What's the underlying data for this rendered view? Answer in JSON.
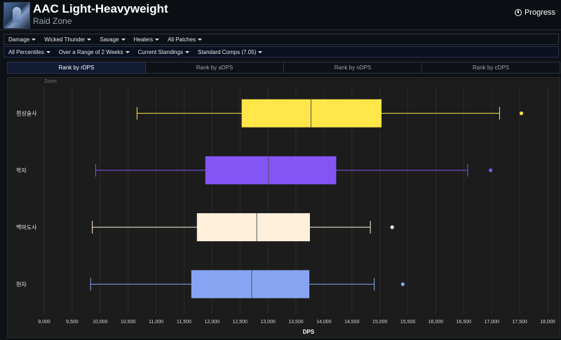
{
  "header": {
    "title": "AAC Light-Heavyweight",
    "subtitle": "Raid Zone",
    "progress_label": "Progress"
  },
  "filters_row1": [
    {
      "label": "Damage"
    },
    {
      "label": "Wicked Thunder"
    },
    {
      "label": "Savage"
    },
    {
      "label": "Healers"
    },
    {
      "label": "All Patches"
    }
  ],
  "filters_row2": [
    {
      "label": "All Percentiles"
    },
    {
      "label": "Over a Range of 2 Weeks"
    },
    {
      "label": "Current Standings"
    },
    {
      "label": "Standard Comps (7.05)"
    }
  ],
  "tabs": [
    {
      "label": "Rank by rDPS",
      "active": true
    },
    {
      "label": "Rank by aDPS",
      "active": false
    },
    {
      "label": "Rank by nDPS",
      "active": false
    },
    {
      "label": "Rank by cDPS",
      "active": false
    }
  ],
  "chart_zoom_label": "Zoom",
  "chart_data": {
    "type": "boxplot",
    "orientation": "horizontal",
    "xlabel": "DPS",
    "xlim": [
      9000,
      18000
    ],
    "xticks": [
      9000,
      9500,
      10000,
      10500,
      11000,
      11500,
      12000,
      12500,
      13000,
      13500,
      14000,
      14500,
      15000,
      15500,
      16000,
      16500,
      17000,
      17500,
      18000
    ],
    "xtick_labels": [
      "9,000",
      "9,500",
      "10,000",
      "10,500",
      "11,000",
      "11,500",
      "12,000",
      "12,500",
      "13,000",
      "13,500",
      "14,000",
      "14,500",
      "15,000",
      "15,500",
      "16,000",
      "16,500",
      "17,000",
      "17,500",
      "18,000"
    ],
    "grid": true,
    "series": [
      {
        "name": "점성술사",
        "color": "#ffe74a",
        "whisker_low": 10660,
        "q1": 12530,
        "median": 13770,
        "q3": 15030,
        "whisker_high": 17140,
        "outliers": [
          17530
        ]
      },
      {
        "name": "학자",
        "color": "#8454f5",
        "whisker_low": 9920,
        "q1": 11880,
        "median": 13010,
        "q3": 14220,
        "whisker_high": 16570,
        "outliers": [
          16980
        ]
      },
      {
        "name": "백마도사",
        "color": "#fff0dc",
        "whisker_low": 9860,
        "q1": 11730,
        "median": 12800,
        "q3": 13750,
        "whisker_high": 14830,
        "outliers": [
          15220
        ]
      },
      {
        "name": "현자",
        "color": "#86a4f1",
        "whisker_low": 9830,
        "q1": 11630,
        "median": 12710,
        "q3": 13740,
        "whisker_high": 14900,
        "outliers": [
          15410
        ]
      }
    ]
  }
}
